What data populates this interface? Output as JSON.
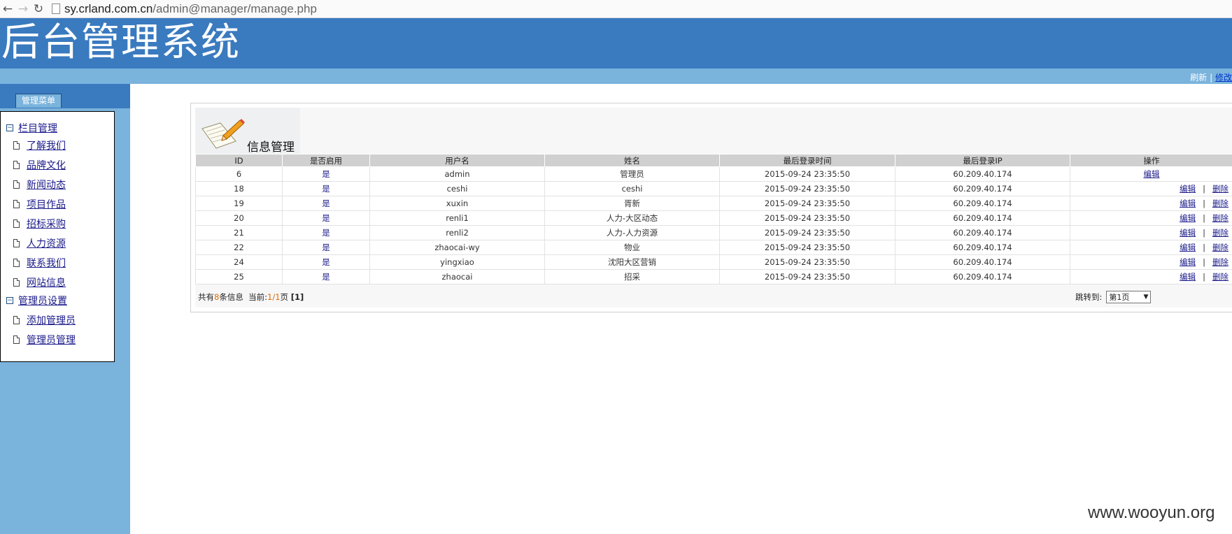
{
  "browser": {
    "back_icon": "arrow-left-icon",
    "forward_icon": "arrow-right-icon",
    "reload_icon": "reload-icon",
    "url_host": "sy.crland.com.cn",
    "url_path": "/admin@manager/manage.php"
  },
  "header": {
    "title": "后台管理系统",
    "link_refresh": "刷新",
    "link_sep": "|",
    "link_modify": "修改"
  },
  "sidebar": {
    "tab_label": "管理菜单",
    "groups": [
      {
        "label": "栏目管理",
        "items": [
          "了解我们",
          "品牌文化",
          "新闻动态",
          "项目作品",
          "招标采购",
          "人力资源",
          "联系我们",
          "网站信息"
        ]
      },
      {
        "label": "管理员设置",
        "items": [
          "添加管理员",
          "管理员管理"
        ]
      }
    ]
  },
  "main": {
    "title": "信息管理",
    "columns": [
      "ID",
      "是否启用",
      "用户名",
      "姓名",
      "最后登录时间",
      "最后登录IP",
      "操作"
    ],
    "rows": [
      {
        "id": "6",
        "enabled": "是",
        "username": "admin",
        "name": "管理员",
        "time": "2015-09-24 23:35:50",
        "ip": "60.209.40.174",
        "ops": [
          "编辑"
        ]
      },
      {
        "id": "18",
        "enabled": "是",
        "username": "ceshi",
        "name": "ceshi",
        "time": "2015-09-24 23:35:50",
        "ip": "60.209.40.174",
        "ops": [
          "编辑",
          "删除"
        ]
      },
      {
        "id": "19",
        "enabled": "是",
        "username": "xuxin",
        "name": "胥新",
        "time": "2015-09-24 23:35:50",
        "ip": "60.209.40.174",
        "ops": [
          "编辑",
          "删除"
        ]
      },
      {
        "id": "20",
        "enabled": "是",
        "username": "renli1",
        "name": "人力-大区动态",
        "time": "2015-09-24 23:35:50",
        "ip": "60.209.40.174",
        "ops": [
          "编辑",
          "删除"
        ]
      },
      {
        "id": "21",
        "enabled": "是",
        "username": "renli2",
        "name": "人力-人力资源",
        "time": "2015-09-24 23:35:50",
        "ip": "60.209.40.174",
        "ops": [
          "编辑",
          "删除"
        ]
      },
      {
        "id": "22",
        "enabled": "是",
        "username": "zhaocai-wy",
        "name": "物业",
        "time": "2015-09-24 23:35:50",
        "ip": "60.209.40.174",
        "ops": [
          "编辑",
          "删除"
        ]
      },
      {
        "id": "24",
        "enabled": "是",
        "username": "yingxiao",
        "name": "沈阳大区营销",
        "time": "2015-09-24 23:35:50",
        "ip": "60.209.40.174",
        "ops": [
          "编辑",
          "删除"
        ]
      },
      {
        "id": "25",
        "enabled": "是",
        "username": "zhaocai",
        "name": "招采",
        "time": "2015-09-24 23:35:50",
        "ip": "60.209.40.174",
        "ops": [
          "编辑",
          "删除"
        ]
      }
    ],
    "ops_separator": "|",
    "footer": {
      "prefix": "共有",
      "count": "8",
      "suffix_info": "条信息  当前:",
      "current": "1/1",
      "page_word": "页",
      "page_links": "[1]"
    },
    "jump_label": "跳转到:",
    "jump_value": "第1页",
    "jump_arrow": "▼"
  },
  "watermark": "www.wooyun.org"
}
